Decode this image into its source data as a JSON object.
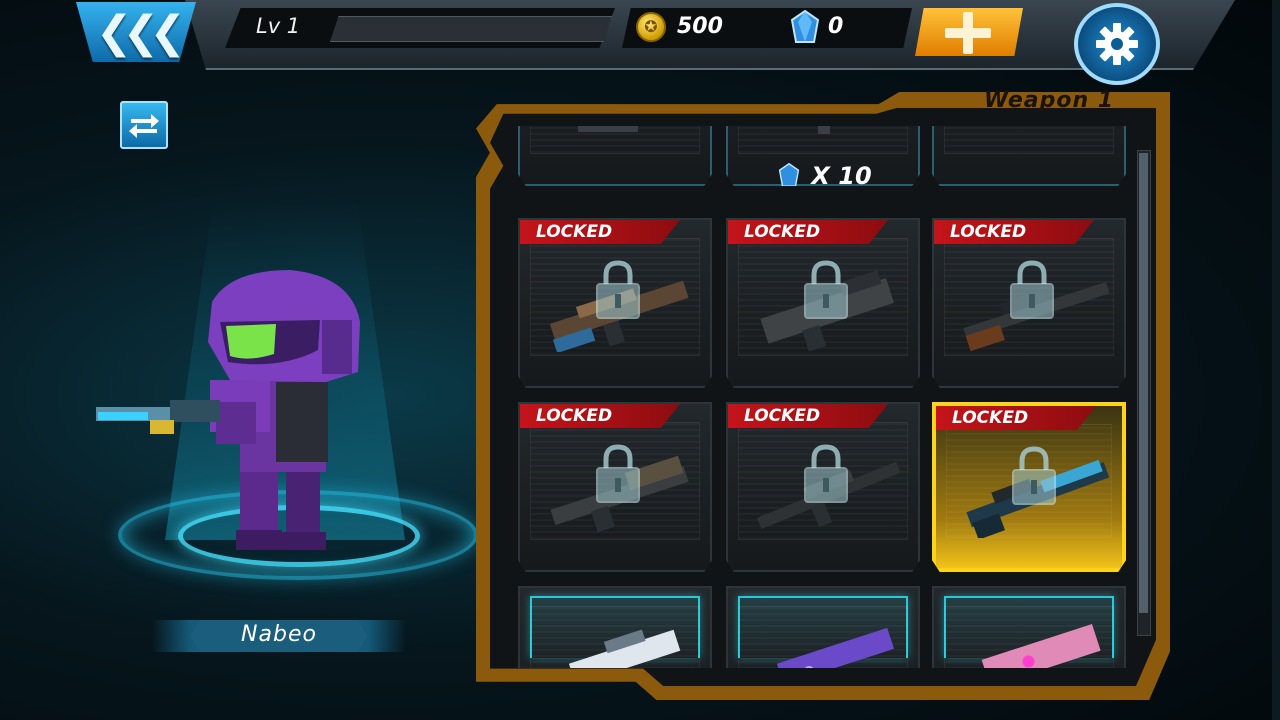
{
  "header": {
    "level_label": "Lv 1",
    "xp_progress": 0,
    "coins": "500",
    "gems": "0"
  },
  "character": {
    "name": "Nabeo"
  },
  "weapon_panel": {
    "title": "Weapon 1",
    "top_row": [
      {
        "price": ""
      },
      {
        "price": "X 10",
        "currency": "gem-icon"
      },
      {
        "price": ""
      }
    ],
    "locked_label": "LOCKED",
    "rows": [
      [
        "LOCKED",
        "LOCKED",
        "LOCKED"
      ],
      [
        "LOCKED",
        "LOCKED",
        "LOCKED"
      ]
    ]
  },
  "colors": {
    "accent_blue": "#2aa6e0",
    "panel_gold": "#8c5a0c",
    "locked_red": "#c4141a",
    "selected_yellow": "#ffd21c"
  }
}
